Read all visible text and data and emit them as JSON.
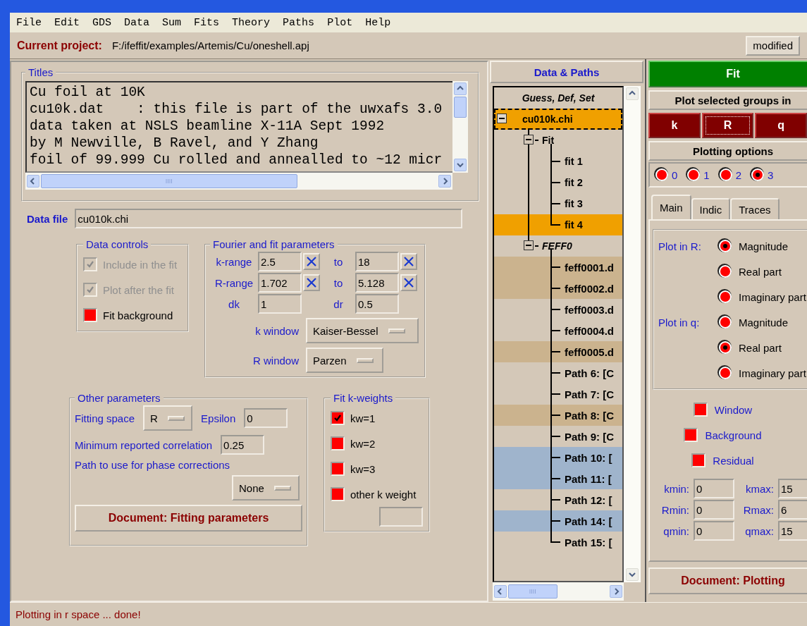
{
  "menu": [
    {
      "label": "File"
    },
    {
      "label": "Edit"
    },
    {
      "label": "GDS"
    },
    {
      "label": "Data"
    },
    {
      "label": "Sum"
    },
    {
      "label": "Fits"
    },
    {
      "label": "Theory"
    },
    {
      "label": "Paths"
    },
    {
      "label": "Plot"
    },
    {
      "label": "Help"
    }
  ],
  "project": {
    "label": "Current project:",
    "path": "F:/ifeffit/examples/Artemis/Cu/oneshell.apj",
    "status_button": "modified"
  },
  "titles": {
    "legend": "Titles",
    "lines": [
      "Cu foil at 10K",
      "cu10k.dat    : this file is part of the uwxafs 3.0",
      "data taken at NSLS beamline X-11A Sept 1992",
      "by M Newville, B Ravel, and Y Zhang",
      "foil of 99.999 Cu rolled and annealled to ~12 micr"
    ]
  },
  "data_file": {
    "label": "Data file",
    "value": "cu010k.chi"
  },
  "data_controls": {
    "legend": "Data controls",
    "items": [
      {
        "label": "Include in the fit",
        "checked": true,
        "disabled": true
      },
      {
        "label": "Plot after the fit",
        "checked": true,
        "disabled": true
      },
      {
        "label": "Fit background",
        "checked": false,
        "disabled": false
      }
    ]
  },
  "fourier": {
    "legend": "Fourier and fit parameters",
    "rows": [
      {
        "label": "k-range",
        "from": "2.5",
        "to_label": "to",
        "to": "18",
        "clearable": true
      },
      {
        "label": "R-range",
        "from": "1.702",
        "to_label": "to",
        "to": "5.128",
        "clearable": true
      },
      {
        "label": "dk",
        "from": "1",
        "to_label": "dr",
        "to": "0.5",
        "clearable": false
      }
    ],
    "windows": [
      {
        "label": "k window",
        "value": "Kaiser-Bessel"
      },
      {
        "label": "R window",
        "value": "Parzen"
      }
    ]
  },
  "other": {
    "legend": "Other parameters",
    "fitting_space": {
      "label": "Fitting space",
      "value": "R"
    },
    "epsilon": {
      "label": "Epsilon",
      "value": "0"
    },
    "correlation": {
      "label": "Minimum reported correlation",
      "value": "0.25"
    },
    "phase": {
      "label": "Path to use for phase corrections",
      "value": "None"
    },
    "document_button": "Document: Fitting parameters"
  },
  "k_weights": {
    "legend": "Fit k-weights",
    "items": [
      {
        "label": "kw=1",
        "checked": true
      },
      {
        "label": "kw=2",
        "checked": false
      },
      {
        "label": "kw=3",
        "checked": false
      },
      {
        "label": "other k weight",
        "checked": false
      }
    ]
  },
  "data_paths": {
    "header": "Data & Paths",
    "tree_header": "Guess, Def, Set",
    "tree": [
      {
        "label": "cu010k.chi",
        "kind": "data",
        "selected": true,
        "expanded": true,
        "children": [
          {
            "label": "Fit",
            "kind": "fit_group",
            "selected": false,
            "expanded": true,
            "children": [
              {
                "label": "fit 1",
                "kind": "fit",
                "selected": false
              },
              {
                "label": "fit 2",
                "kind": "fit",
                "selected": false
              },
              {
                "label": "fit 3",
                "kind": "fit",
                "selected": false
              },
              {
                "label": "fit 4",
                "kind": "fit",
                "selected": true
              }
            ]
          },
          {
            "label": "FEFF0",
            "kind": "feff_group",
            "selected": false,
            "expanded": true,
            "children": [
              {
                "label": "feff0001.d",
                "kind": "path",
                "selected": false,
                "color": "#cbb38e"
              },
              {
                "label": "feff0002.d",
                "kind": "path",
                "selected": false,
                "color": "#cbb38e"
              },
              {
                "label": "feff0003.d",
                "kind": "path",
                "selected": false
              },
              {
                "label": "feff0004.d",
                "kind": "path",
                "selected": false
              },
              {
                "label": "feff0005.d",
                "kind": "path",
                "selected": false,
                "color": "#cbb38e"
              },
              {
                "label": "Path 6: [C",
                "kind": "path",
                "selected": false
              },
              {
                "label": "Path 7: [C",
                "kind": "path",
                "selected": false
              },
              {
                "label": "Path 8: [C",
                "kind": "path",
                "selected": false,
                "color": "#cbb38e"
              },
              {
                "label": "Path 9: [C",
                "kind": "path",
                "selected": false
              },
              {
                "label": "Path 10: [",
                "kind": "path",
                "selected": false,
                "color": "#9fb4cc"
              },
              {
                "label": "Path 11: [",
                "kind": "path",
                "selected": false,
                "color": "#9fb4cc"
              },
              {
                "label": "Path 12: [",
                "kind": "path",
                "selected": false
              },
              {
                "label": "Path 14: [",
                "kind": "path",
                "selected": false,
                "color": "#9fb4cc"
              },
              {
                "label": "Path 15: [",
                "kind": "path",
                "selected": false
              }
            ]
          }
        ]
      }
    ]
  },
  "plotting": {
    "fit_button": "Fit",
    "plot_in_label": "Plot selected groups in",
    "plot_buttons": [
      {
        "label": "k",
        "focused": false
      },
      {
        "label": "R",
        "focused": true
      },
      {
        "label": "q",
        "focused": false
      }
    ],
    "options_header": "Plotting options",
    "kweights": [
      {
        "label": "0",
        "selected": false
      },
      {
        "label": "1",
        "selected": false
      },
      {
        "label": "2",
        "selected": false
      },
      {
        "label": "3",
        "selected": true
      }
    ],
    "tabs": [
      {
        "label": "Main",
        "selected": true
      },
      {
        "label": "Indic",
        "selected": false
      },
      {
        "label": "Traces",
        "selected": false
      }
    ],
    "groups": [
      {
        "label": "Plot in R:",
        "options": [
          {
            "label": "Magnitude",
            "selected": true
          },
          {
            "label": "Real part",
            "selected": false
          },
          {
            "label": "Imaginary part",
            "selected": false
          }
        ]
      },
      {
        "label": "Plot in q:",
        "options": [
          {
            "label": "Magnitude",
            "selected": false
          },
          {
            "label": "Real part",
            "selected": true
          },
          {
            "label": "Imaginary part",
            "selected": false
          }
        ]
      }
    ],
    "checks": [
      {
        "label": "Window",
        "checked": false
      },
      {
        "label": "Background",
        "checked": false
      },
      {
        "label": "Residual",
        "checked": false
      }
    ],
    "ranges": [
      {
        "label": "kmin:",
        "value": "0"
      },
      {
        "label": "kmax:",
        "value": "15"
      },
      {
        "label": "Rmin:",
        "value": "0"
      },
      {
        "label": "Rmax:",
        "value": "6"
      },
      {
        "label": "qmin:",
        "value": "0"
      },
      {
        "label": "qmax:",
        "value": "15"
      }
    ],
    "document_button": "Document: Plotting"
  },
  "status_bar": "Plotting in r space ... done!"
}
